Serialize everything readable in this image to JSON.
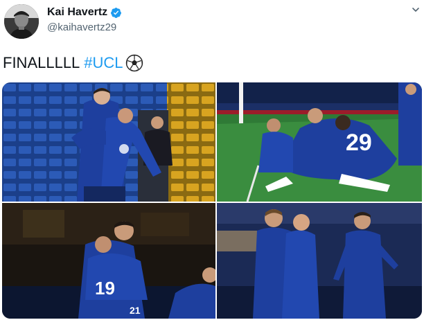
{
  "author": {
    "display_name": "Kai Havertz",
    "handle": "@kaihavertz29",
    "verified": true,
    "avatar_icon": "profile-photo"
  },
  "tweet": {
    "text": "FINALLLLL",
    "hashtag": "#UCL",
    "emoji": "soccer-ball-icon"
  },
  "media": {
    "photos": [
      {
        "alt": "Chelsea players embracing in front of blue stadium seats"
      },
      {
        "alt": "Chelsea players piled up celebrating a goal, number 29 on top"
      },
      {
        "alt": "Chelsea players hugging on the pitch at night, number 19 and 21"
      },
      {
        "alt": "Chelsea players celebrating together in front of the stands"
      }
    ],
    "jersey_numbers": [
      "29",
      "19",
      "21"
    ]
  },
  "colors": {
    "accent": "#1d9bf0",
    "text": "#0f1419",
    "muted": "#536471",
    "chelsea_blue": "#1e3f9e"
  }
}
